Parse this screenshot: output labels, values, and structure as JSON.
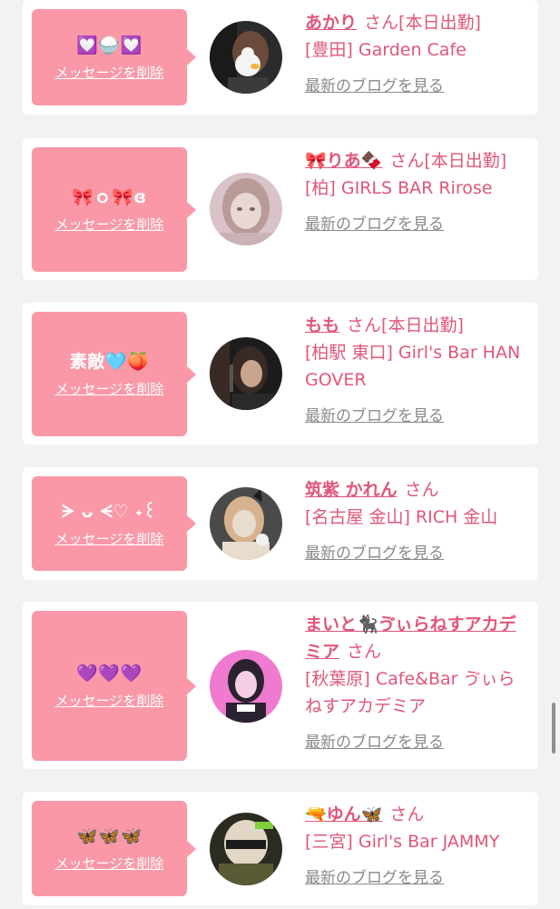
{
  "entries": [
    {
      "message": "💟🍚💟",
      "delete_label": "メッセージを削除",
      "name": "あかり",
      "san": "さん",
      "status": "[本日出勤]",
      "shop": "[豊田] Garden Cafe",
      "blog_label": "最新のブログを見る",
      "avatar_colors": [
        "#2b2b2b",
        "#f4f4f4",
        "#6a4a3a"
      ]
    },
    {
      "message": "🎀ｏ🎀ɞ",
      "delete_label": "メッセージを削除",
      "name": "🎀りあ🍫",
      "san": "さん",
      "status": "[本日出勤]",
      "shop": "[柏] GIRLS BAR Rirose",
      "blog_label": "最新のブログを見る",
      "avatar_colors": [
        "#d9c3c8",
        "#e9d7d4",
        "#b89a97"
      ]
    },
    {
      "message": "素敵🩵🍑",
      "delete_label": "メッセージを削除",
      "name": "もも",
      "san": "さん",
      "status": "[本日出勤]",
      "shop": "[柏駅 東口] Girl's Bar HANGOVER",
      "blog_label": "最新のブログを見る",
      "avatar_colors": [
        "#3a2a26",
        "#c9a48f",
        "#1c1c1c"
      ]
    },
    {
      "message": "ᗒ ᴗ ᗕ♡ ˖꒰",
      "delete_label": "メッセージを削除",
      "name": "筑紫 かれん",
      "san": "さん",
      "status": "",
      "shop": "[名古屋 金山] RICH 金山",
      "blog_label": "最新のブログを見る",
      "avatar_colors": [
        "#4a4a4a",
        "#e8dccd",
        "#d6b28e"
      ]
    },
    {
      "message": "💜💜💜",
      "delete_label": "メッセージを削除",
      "name": "まいと🐈‍⬛ゔぃらねすアカデミア",
      "san": "さん",
      "status": "",
      "shop": "[秋葉原] Cafe&Bar ゔぃらねすアカデミア",
      "blog_label": "最新のブログを見る",
      "avatar_colors": [
        "#f07ad0",
        "#f4cfe3",
        "#2a2230"
      ]
    },
    {
      "message": "🦋🦋🦋",
      "delete_label": "メッセージを削除",
      "name": "🔫ゆん🦋",
      "san": "さん",
      "status": "",
      "shop": "[三宮] Girl's Bar JAMMY",
      "blog_label": "最新のブログを見る",
      "avatar_colors": [
        "#5b5a36",
        "#e2d6c4",
        "#2b2b22"
      ]
    }
  ]
}
